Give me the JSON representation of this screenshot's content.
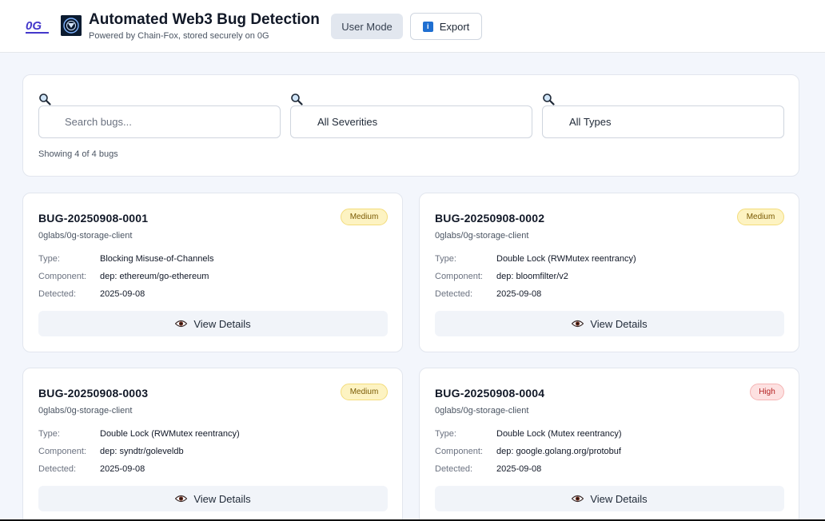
{
  "header": {
    "title": "Automated Web3 Bug Detection",
    "subtitle": "Powered by Chain-Fox, stored securely on 0G",
    "user_mode_label": "User Mode",
    "export_label": "Export",
    "logo_text": "0G"
  },
  "filters": {
    "search_placeholder": "Search bugs...",
    "severity_value": "All Severities",
    "type_value": "All Types",
    "results_text": "Showing 4 of 4 bugs"
  },
  "labels": {
    "type": "Type:",
    "component": "Component:",
    "detected": "Detected:",
    "view_details": "View Details"
  },
  "bugs": [
    {
      "id": "BUG-20250908-0001",
      "severity": "Medium",
      "repo": "0glabs/0g-storage-client",
      "type": "Blocking Misuse-of-Channels",
      "component": "dep: ethereum/go-ethereum",
      "detected": "2025-09-08"
    },
    {
      "id": "BUG-20250908-0002",
      "severity": "Medium",
      "repo": "0glabs/0g-storage-client",
      "type": "Double Lock (RWMutex reentrancy)",
      "component": "dep: bloomfilter/v2",
      "detected": "2025-09-08"
    },
    {
      "id": "BUG-20250908-0003",
      "severity": "Medium",
      "repo": "0glabs/0g-storage-client",
      "type": "Double Lock (RWMutex reentrancy)",
      "component": "dep: syndtr/goleveldb",
      "detected": "2025-09-08"
    },
    {
      "id": "BUG-20250908-0004",
      "severity": "High",
      "repo": "0glabs/0g-storage-client",
      "type": "Double Lock (Mutex reentrancy)",
      "component": "dep: google.golang.org/protobuf",
      "detected": "2025-09-08"
    }
  ],
  "colors": {
    "medium_badge_bg": "#fdf3c2",
    "high_badge_bg": "#fde1e1",
    "accent_logo": "#4f46e5"
  }
}
